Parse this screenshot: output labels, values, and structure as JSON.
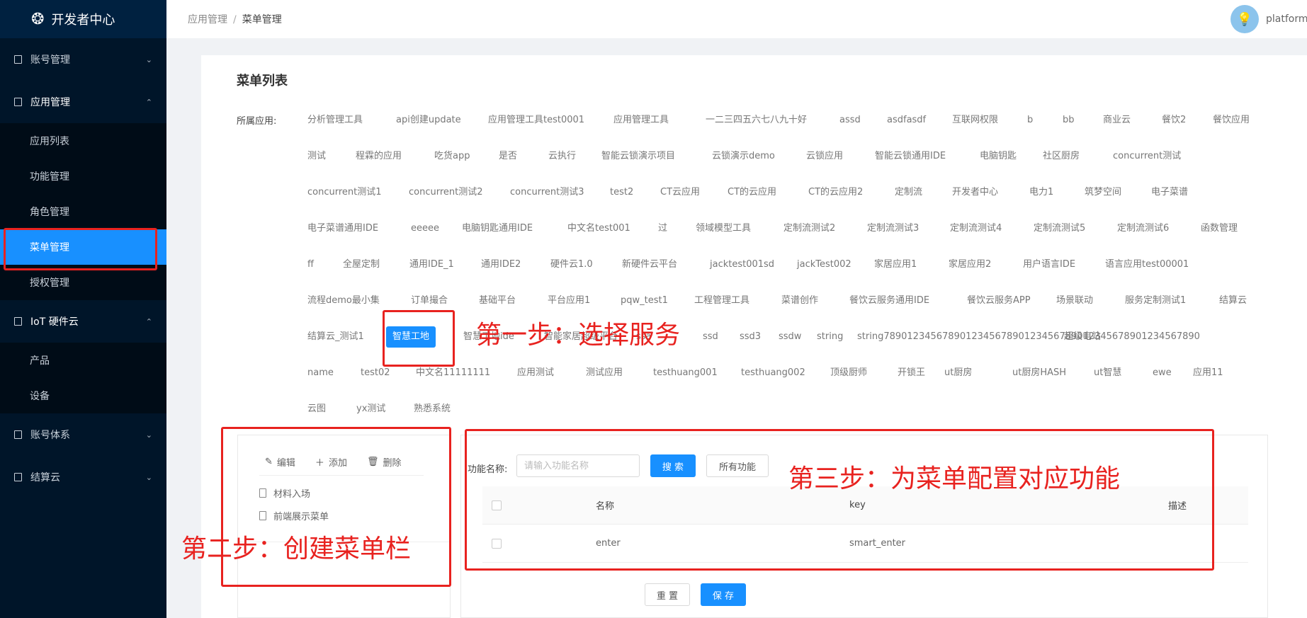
{
  "sidebar": {
    "logo_icon": "swirl-logo",
    "logo_text": "开发者中心",
    "items": [
      {
        "label": "账号管理",
        "chevron": "⌄"
      },
      {
        "label": "应用管理",
        "chevron": "⌃"
      },
      {
        "label": "IoT 硬件云",
        "chevron": "⌃"
      },
      {
        "label": "账号体系",
        "chevron": "⌄"
      },
      {
        "label": "结算云",
        "chevron": "⌄"
      }
    ],
    "app_sub": [
      "应用列表",
      "功能管理",
      "角色管理",
      "菜单管理",
      "授权管理"
    ],
    "iot_sub": [
      "产品",
      "设备"
    ],
    "active_color": "#1890ff"
  },
  "header": {
    "breadcrumb": [
      "应用管理",
      "菜单管理"
    ],
    "separator": "/",
    "user_name": "platform_"
  },
  "card": {
    "title": "菜单列表",
    "app_label": "所属应用:",
    "apps": [
      [
        "分析管理工具",
        "api创建update",
        "应用管理工具test0001",
        "应用管理工具",
        "一二三四五六七八九十好",
        "assd",
        "asdfasdf",
        "互联网权限",
        "b",
        "bb",
        "商业云",
        "餐饮2",
        "餐饮应用"
      ],
      [
        "测试",
        "程霖的应用",
        "吃货app",
        "是否",
        "云执行",
        "智能云锁演示项目",
        "云锁演示demo",
        "云锁应用",
        "智能云锁通用IDE",
        "电脑钥匙",
        "社区厨房",
        "concurrent测试"
      ],
      [
        "concurrent测试1",
        "concurrent测试2",
        "concurrent测试3",
        "test2",
        "CT云应用",
        "CT的云应用",
        "CT的云应用2",
        "定制流",
        "开发者中心",
        "电力1",
        "筑梦空间",
        "电子菜谱"
      ],
      [
        "电子菜谱通用IDE",
        "eeeee",
        "电脑钥匙通用IDE",
        "中文名test001",
        "过",
        "领域模型工具",
        "定制流测试2",
        "定制流测试3",
        "定制流测试4",
        "定制流测试5",
        "定制流测试6",
        "函数管理"
      ],
      [
        "ff",
        "全屋定制",
        "通用IDE_1",
        "通用IDE2",
        "硬件云1.0",
        "新硬件云平台",
        "jacktest001sd",
        "jackTest002",
        "家居应用1",
        "家居应用2",
        "用户语言IDE",
        "语言应用test00001"
      ],
      [
        "流程demo最小集",
        "订单撮合",
        "基础平台",
        "平台应用1",
        "pqw_test1",
        "工程管理工具",
        "菜谱创作",
        "餐饮云服务通用IDE",
        "餐饮云服务APP",
        "场景联动",
        "服务定制测试1",
        "结算云"
      ],
      [
        "结算云_测试1",
        "智慧工地",
        "智慧工地ide",
        "智能家居超级平台",
        "ssa",
        "ssd",
        "ssd3",
        "ssdw",
        "string",
        "string789012345678901234567890123456789012345678901234567890",
        "超级电站"
      ],
      [
        "name",
        "test02",
        "中文名11111111",
        "应用测试",
        "测试应用",
        "testhuang001",
        "testhuang002",
        "顶级厨师",
        "开锁王",
        "ut厨房",
        "ut厨房HASH",
        "ut智慧",
        "ewe",
        "应用11"
      ],
      [
        "云图",
        "yx测试",
        "熟悉系统"
      ]
    ],
    "selected_app": "智慧工地"
  },
  "tree": {
    "edit_label": "编辑",
    "add_label": "添加",
    "delete_label": "删除",
    "nodes": [
      "材料入场",
      "前端展示菜单"
    ]
  },
  "functions": {
    "search_label": "功能名称:",
    "search_placeholder": "请输入功能名称",
    "search_button": "搜 索",
    "all_button": "所有功能",
    "columns": [
      "名称",
      "key",
      "描述"
    ],
    "rows": [
      {
        "name": "enter",
        "key": "smart_enter",
        "desc": ""
      }
    ]
  },
  "footer": {
    "reset_label": "重 置",
    "save_label": "保 存"
  },
  "annotations": {
    "step1": "第一步：选择服务",
    "step2": "第二步：创建菜单栏",
    "step3": "第三步：为菜单配置对应功能",
    "color": "#e8221f"
  }
}
